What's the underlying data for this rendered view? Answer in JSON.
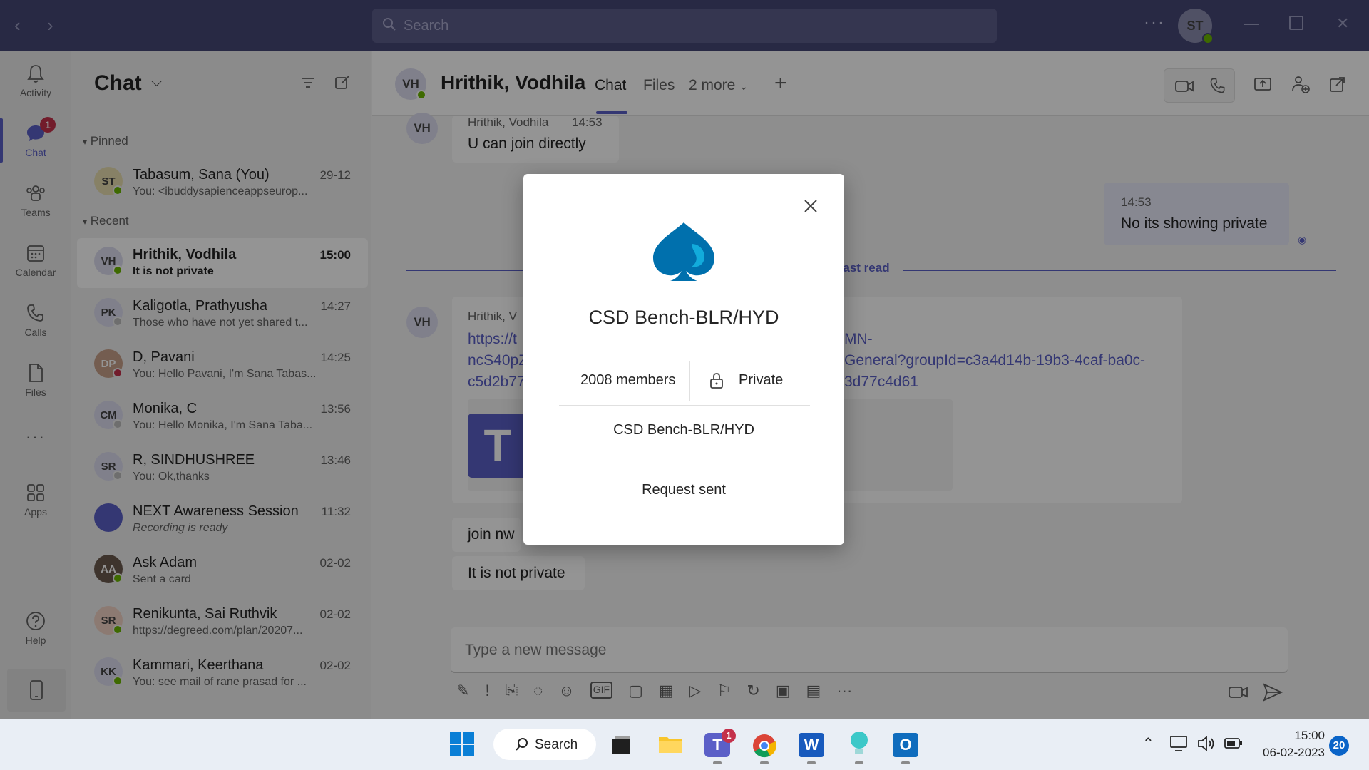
{
  "titlebar": {
    "search_placeholder": "Search",
    "profile_initials": "ST"
  },
  "rail": {
    "items": [
      {
        "label": "Activity"
      },
      {
        "label": "Chat",
        "badge": "1"
      },
      {
        "label": "Teams"
      },
      {
        "label": "Calendar"
      },
      {
        "label": "Calls"
      },
      {
        "label": "Files"
      },
      {
        "label": "Apps"
      },
      {
        "label": "Help"
      }
    ],
    "more": "···"
  },
  "chatlist": {
    "title": "Chat",
    "pinned_label": "Pinned",
    "recent_label": "Recent",
    "pinned": [
      {
        "initials": "ST",
        "name": "Tabasum, Sana (You)",
        "preview": "You: <ibuddysapienceappseurop...",
        "time": "29-12",
        "avatar_color": "#e8dfb0",
        "presence": "#6bb700"
      }
    ],
    "recent": [
      {
        "initials": "VH",
        "name": "Hrithik, Vodhila",
        "preview": "It is not private",
        "time": "15:00",
        "avatar_color": "#dcdcf0",
        "presence": "#6bb700",
        "selected": true
      },
      {
        "initials": "PK",
        "name": "Kaligotla, Prathyusha",
        "preview": "Those who have not yet shared t...",
        "time": "14:27",
        "avatar_color": "#dcdcf0",
        "presence": "#bdbdbd"
      },
      {
        "initials": "DP",
        "name": "D, Pavani",
        "preview": "You: Hello Pavani, I'm Sana Tabas...",
        "time": "14:25",
        "avatar_color": "#c9a08a",
        "presence": "#c4314b"
      },
      {
        "initials": "CM",
        "name": "Monika, C",
        "preview": "You: Hello Monika, I'm Sana Taba...",
        "time": "13:56",
        "avatar_color": "#dcdcf0",
        "presence": "#bdbdbd"
      },
      {
        "initials": "SR",
        "name": "R, SINDHUSHREE",
        "preview": "You: Ok,thanks",
        "time": "13:46",
        "avatar_color": "#dcdcf0",
        "presence": "#bdbdbd"
      },
      {
        "initials": "",
        "name": "NEXT Awareness Session",
        "preview": "Recording is ready",
        "time": "11:32",
        "avatar_color": "#5b5fc7",
        "presence": ""
      },
      {
        "initials": "AA",
        "name": "Ask Adam",
        "preview": "Sent a card",
        "time": "02-02",
        "avatar_color": "#6b5a4e",
        "presence": "#6bb700"
      },
      {
        "initials": "SR",
        "name": "Renikunta, Sai Ruthvik",
        "preview": "https://degreed.com/plan/20207...",
        "time": "02-02",
        "avatar_color": "#f2d3c4",
        "presence": "#6bb700"
      },
      {
        "initials": "KK",
        "name": "Kammari, Keerthana",
        "preview": "You: see mail of rane prasad for ...",
        "time": "02-02",
        "avatar_color": "#dcdcf0",
        "presence": "#6bb700"
      }
    ]
  },
  "header": {
    "initials": "VH",
    "name": "Hrithik, Vodhila",
    "tabs": [
      "Chat",
      "Files",
      "2 more"
    ]
  },
  "messages": {
    "m1_sender": "Hrithik, Vodhila",
    "m1_time": "14:53",
    "m1_text": "U can join directly",
    "m2_time": "14:53",
    "m2_text": "No its showing private",
    "last_read": "Last read",
    "m3_sender": "Hrithik, V",
    "link_line1a": "https://t",
    "link_line1b": "MN-",
    "link_line2a": "ncS40pZ",
    "link_line2b": "General?groupId=c3a4d14b-19b3-4caf-ba0c-",
    "link_line3a": "c5d2b77",
    "link_line3b": "3d77c4d61",
    "m4_text": "join nw",
    "m5_text": "It is not private",
    "compose_placeholder": "Type a new message"
  },
  "modal": {
    "team_name": "CSD Bench-BLR/HYD",
    "members": "2008 members",
    "privacy": "Private",
    "description": "CSD Bench-BLR/HYD",
    "status": "Request sent"
  },
  "taskbar": {
    "search_label": "Search",
    "teams_badge": "1",
    "time": "15:00",
    "date": "06-02-2023",
    "notification_count": "20"
  },
  "colors": {
    "titlebar": "#464775",
    "accent": "#5b5fc7",
    "brand_blue": "#0070ad"
  }
}
